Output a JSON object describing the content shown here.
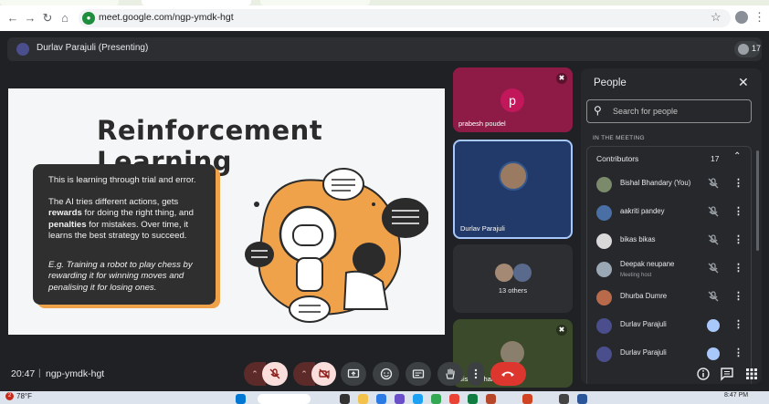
{
  "browser": {
    "url": "meet.google.com/ngp-ymdk-hgt",
    "nav_icons": [
      "back-icon",
      "forward-icon",
      "reload-icon",
      "home-icon"
    ]
  },
  "meet": {
    "presenting_label": "Durlav Parajuli (Presenting)",
    "participant_count": "17",
    "clock": "20:47",
    "separator": "|",
    "meeting_code": "ngp-ymdk-hgt"
  },
  "slide": {
    "title": "Reinforcement Learning",
    "para1": "This is learning through trial and error.",
    "para2_prefix": "The AI tries different actions, gets ",
    "para2_bold1": "rewards",
    "para2_mid": " for doing the right thing, and ",
    "para2_bold2": "penalties",
    "para2_suffix": " for mistakes. Over time, it learns the best strategy to succeed.",
    "para3": "E.g. Training a robot to play chess by rewarding it for winning moves and penalising it for losing ones."
  },
  "tiles": [
    {
      "name": "prabesh poudel",
      "initial": "p",
      "muted": true
    },
    {
      "name": "Durlav Parajuli",
      "muted": false
    },
    {
      "label": "13 others"
    },
    {
      "name": "Bishal Bhandary",
      "muted": true
    }
  ],
  "people_panel": {
    "title": "People",
    "search_placeholder": "Search for people",
    "section_label": "IN THE MEETING",
    "group_label": "Contributors",
    "group_count": "17",
    "people": [
      {
        "name": "Bishal Bhandary (You)",
        "role": "",
        "muted": true,
        "avatar_color": "#7a8a6a"
      },
      {
        "name": "aakriti pandey",
        "role": "",
        "muted": true,
        "avatar_color": "#4a6fa5"
      },
      {
        "name": "bikas bikas",
        "role": "",
        "muted": true,
        "avatar_color": "#d9d9d9"
      },
      {
        "name": "Deepak neupane",
        "role": "Meeting host",
        "muted": true,
        "avatar_color": "#9aa7b5"
      },
      {
        "name": "Dhurba Dumre",
        "role": "",
        "muted": true,
        "avatar_color": "#b86a4a"
      },
      {
        "name": "Durlav Parajuli",
        "role": "",
        "muted": false,
        "avatar_color": "#4a4e8c"
      },
      {
        "name": "Durlav Parajuli",
        "role": "",
        "muted": false,
        "avatar_color": "#4a4e8c"
      }
    ]
  },
  "taskbar": {
    "weather_badge": "2",
    "weather": "78°F",
    "time": "8:47 PM"
  },
  "colors": {
    "meet_bg": "#202124",
    "end_call": "#dc362e",
    "accent_blue": "#a8c7fa",
    "slide_orange": "#f0a24b"
  }
}
